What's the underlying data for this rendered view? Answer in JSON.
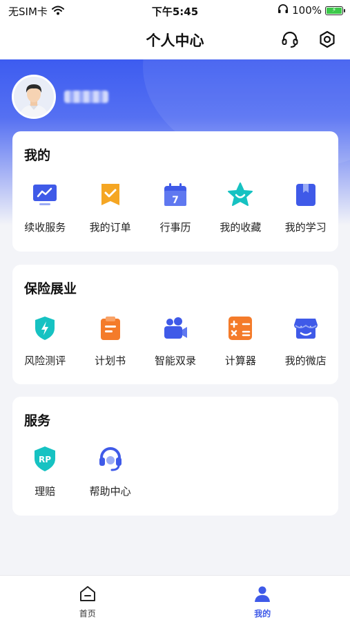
{
  "status_bar": {
    "carrier": "无SIM卡",
    "time": "下午5:45",
    "battery": "100%"
  },
  "nav": {
    "title": "个人中心",
    "icons": [
      "headset-icon",
      "settings-icon"
    ]
  },
  "colors": {
    "brand": "#3f5ae8",
    "orange": "#f5a623",
    "teal": "#16c2c2"
  },
  "sections": {
    "my": {
      "title": "我的",
      "items": [
        {
          "label": "续收服务",
          "icon": "monitor-chart-icon"
        },
        {
          "label": "我的订单",
          "icon": "order-bookmark-icon"
        },
        {
          "label": "行事历",
          "icon": "calendar-icon"
        },
        {
          "label": "我的收藏",
          "icon": "star-icon"
        },
        {
          "label": "我的学习",
          "icon": "book-icon"
        }
      ]
    },
    "insurance": {
      "title": "保险展业",
      "items": [
        {
          "label": "风险测评",
          "icon": "shield-bolt-icon"
        },
        {
          "label": "计划书",
          "icon": "clipboard-icon"
        },
        {
          "label": "智能双录",
          "icon": "video-record-icon"
        },
        {
          "label": "计算器",
          "icon": "calculator-icon"
        },
        {
          "label": "我的微店",
          "icon": "shop-icon"
        }
      ]
    },
    "service": {
      "title": "服务",
      "items": [
        {
          "label": "理赔",
          "icon": "rp-shield-icon"
        },
        {
          "label": "帮助中心",
          "icon": "headset-help-icon"
        }
      ]
    }
  },
  "tabs": [
    {
      "label": "首页",
      "icon": "home-icon",
      "active": false
    },
    {
      "label": "我的",
      "icon": "user-icon",
      "active": true
    }
  ]
}
